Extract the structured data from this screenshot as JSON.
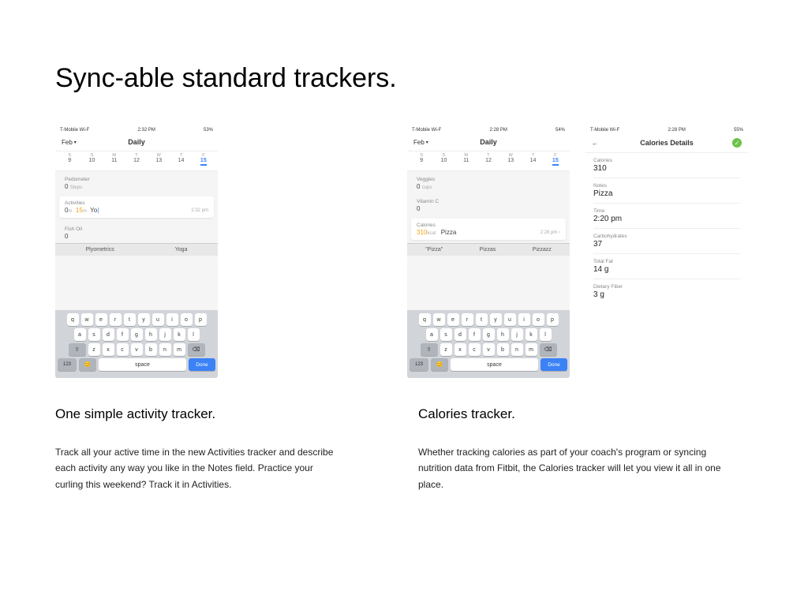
{
  "pageTitle": "Sync-able standard trackers.",
  "statusBar": {
    "carrier": "T-Mobile Wi-F",
    "time": "2:32 PM",
    "battery": "53%"
  },
  "statusBar2": {
    "carrier": "T-Mobile Wi-F",
    "time": "2:28 PM",
    "battery": "54%"
  },
  "statusBar3": {
    "carrier": "T-Mobile Wi-F",
    "time": "2:28 PM",
    "battery": "55%"
  },
  "nav": {
    "month": "Feb",
    "view": "Daily",
    "detailsTitle": "Calories Details",
    "back": "←"
  },
  "week": {
    "labels": [
      "S",
      "S",
      "M",
      "T",
      "W",
      "T",
      "F"
    ],
    "nums": [
      "9",
      "10",
      "11",
      "12",
      "13",
      "14",
      "15"
    ]
  },
  "phone1": {
    "pedometer": {
      "label": "Pedometer",
      "value": "0",
      "unit": "Steps"
    },
    "activities": {
      "label": "Activities",
      "v1": "0",
      "v2": "15",
      "v2unit": "m",
      "typed": "Yo",
      "time": "2:32 pm"
    },
    "fishoil": {
      "label": "Fish Oil",
      "value": "0"
    },
    "suggest": [
      "Plyometrics",
      "Yoga"
    ]
  },
  "phone2": {
    "veggies": {
      "label": "Veggies",
      "value": "0",
      "unit": "cups"
    },
    "vitc": {
      "label": "Vitamin C",
      "value": "0"
    },
    "calories": {
      "label": "Calories",
      "value": "310",
      "unit": "kcal",
      "note": "Pizza",
      "time": "2:28 pm"
    },
    "suggest": [
      "\"Pizza\"",
      "Pizzas",
      "Pizzazz"
    ]
  },
  "details": {
    "fields": [
      {
        "label": "Calories",
        "value": "310"
      },
      {
        "label": "Notes",
        "value": "Pizza"
      },
      {
        "label": "Time",
        "value": "2:20 pm"
      },
      {
        "label": "Carbohydrates",
        "value": "37"
      },
      {
        "label": "Total Fat",
        "value": "14 g"
      },
      {
        "label": "Dietary Fiber",
        "value": "3 g"
      }
    ]
  },
  "keyboard": {
    "row1": [
      "q",
      "w",
      "e",
      "r",
      "t",
      "y",
      "u",
      "i",
      "o",
      "p"
    ],
    "row2": [
      "a",
      "s",
      "d",
      "f",
      "g",
      "h",
      "j",
      "k",
      "l"
    ],
    "row3": [
      "z",
      "x",
      "c",
      "v",
      "b",
      "n",
      "m"
    ],
    "shift": "⇧",
    "del": "⌫",
    "num": "123",
    "emoji": "😊",
    "space": "space",
    "done": "Done"
  },
  "captions": {
    "left": {
      "title": "One simple activity tracker.",
      "body": "Track all your active time in the new Activities tracker and describe each activity any way you like in the Notes field. Practice your curling this weekend? Track it in Activities."
    },
    "right": {
      "title": "Calories tracker.",
      "body": "Whether tracking calories as part of your coach's program or syncing nutrition data from Fitbit, the Calories tracker will let you view it all in one place."
    }
  }
}
